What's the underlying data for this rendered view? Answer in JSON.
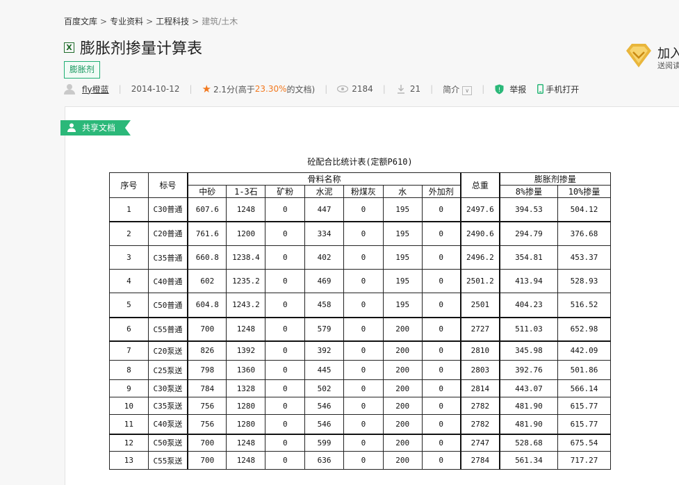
{
  "breadcrumb": [
    "百度文库",
    "专业资料",
    "工程科技",
    "建筑/土木"
  ],
  "title": "膨胀剂掺量计算表",
  "tag": "膨胀剂",
  "meta": {
    "author": "fly橙蓝",
    "date": "2014-10-12",
    "score": "2.1分(高于",
    "score_pct": "23.30%",
    "score_tail": "的文档)",
    "views": "2184",
    "downloads": "21",
    "intro": "简介",
    "report": "举报",
    "mobile": "手机打开"
  },
  "vip": {
    "title": "加入",
    "subtitle": "送阅读"
  },
  "shared_badge": "共享文档",
  "table": {
    "title": "砼配合比统计表(定额P610)",
    "headers": {
      "index": "序号",
      "grade": "标号",
      "materials": "骨料名称",
      "total": "总重",
      "expansion": "膨胀剂掺量",
      "sub": [
        "中砂",
        "1-3石",
        "矿粉",
        "水泥",
        "粉煤灰",
        "水",
        "外加剂"
      ],
      "exp_sub": [
        "8%掺量",
        "10%掺量"
      ]
    },
    "rows": [
      [
        "1",
        "C30普通",
        "607.6",
        "1248",
        "0",
        "447",
        "0",
        "195",
        "0",
        "2497.6",
        "394.53",
        "504.12"
      ],
      [
        "2",
        "C20普通",
        "761.6",
        "1200",
        "0",
        "334",
        "0",
        "195",
        "0",
        "2490.6",
        "294.79",
        "376.68"
      ],
      [
        "3",
        "C35普通",
        "660.8",
        "1238.4",
        "0",
        "402",
        "0",
        "195",
        "0",
        "2496.2",
        "354.81",
        "453.37"
      ],
      [
        "4",
        "C40普通",
        "602",
        "1235.2",
        "0",
        "469",
        "0",
        "195",
        "0",
        "2501.2",
        "413.94",
        "528.93"
      ],
      [
        "5",
        "C50普通",
        "604.8",
        "1243.2",
        "0",
        "458",
        "0",
        "195",
        "0",
        "2501",
        "404.23",
        "516.52"
      ],
      [
        "6",
        "C55普通",
        "700",
        "1248",
        "0",
        "579",
        "0",
        "200",
        "0",
        "2727",
        "511.03",
        "652.98"
      ],
      [
        "7",
        "C20泵送",
        "826",
        "1392",
        "0",
        "392",
        "0",
        "200",
        "0",
        "2810",
        "345.98",
        "442.09"
      ],
      [
        "8",
        "C25泵送",
        "798",
        "1360",
        "0",
        "445",
        "0",
        "200",
        "0",
        "2803",
        "392.76",
        "501.86"
      ],
      [
        "9",
        "C30泵送",
        "784",
        "1328",
        "0",
        "502",
        "0",
        "200",
        "0",
        "2814",
        "443.07",
        "566.14"
      ],
      [
        "10",
        "C35泵送",
        "756",
        "1280",
        "0",
        "546",
        "0",
        "200",
        "0",
        "2782",
        "481.90",
        "615.77"
      ],
      [
        "11",
        "C40泵送",
        "756",
        "1280",
        "0",
        "546",
        "0",
        "200",
        "0",
        "2782",
        "481.90",
        "615.77"
      ],
      [
        "12",
        "C50泵送",
        "700",
        "1248",
        "0",
        "599",
        "0",
        "200",
        "0",
        "2747",
        "528.68",
        "675.54"
      ],
      [
        "13",
        "C55泵送",
        "700",
        "1248",
        "0",
        "636",
        "0",
        "200",
        "0",
        "2784",
        "561.34",
        "717.27"
      ]
    ]
  },
  "colors": {
    "accent_green": "#2bb879",
    "star_orange": "#f2791f"
  }
}
